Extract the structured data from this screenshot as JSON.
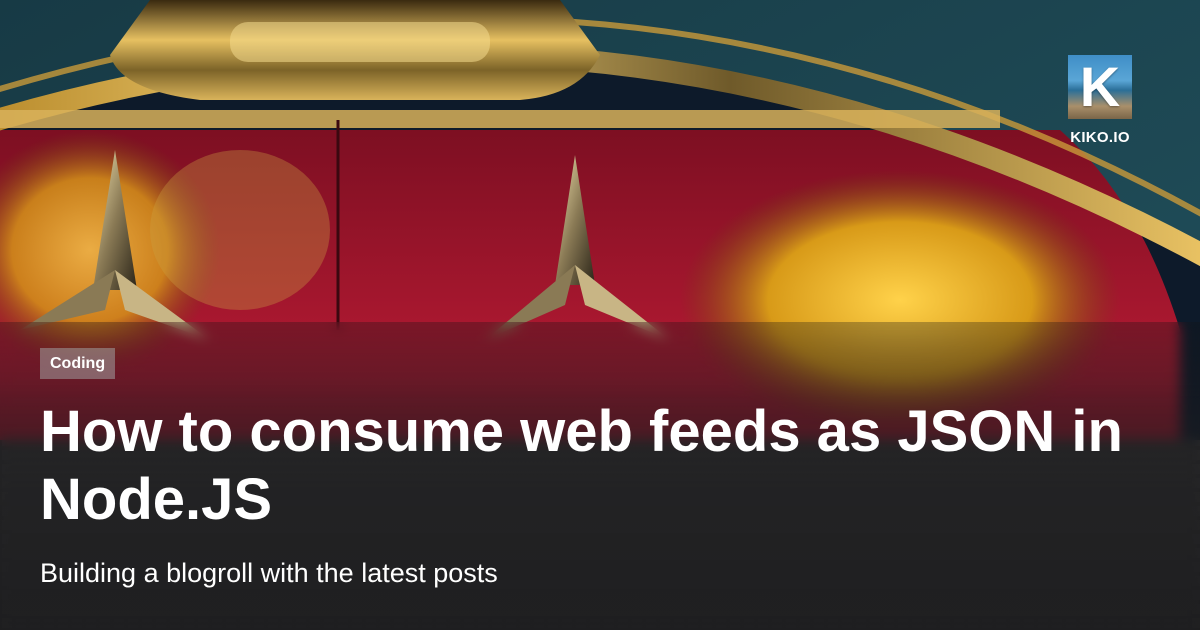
{
  "site": {
    "name": "KIKO.IO",
    "logo_letter": "K"
  },
  "article": {
    "category": "Coding",
    "title": "How to consume web feeds as JSON in Node.JS",
    "subtitle": "Building a blogroll with the latest posts"
  },
  "colors": {
    "background_teal": "#1f4c57",
    "red_panel": "#a3142c",
    "chrome_gold": "#e0a52a",
    "overlay_dark": "#1e1e20",
    "text": "#ffffff"
  },
  "hero_image": {
    "description_icon": "chrome-car-grille-photo"
  }
}
